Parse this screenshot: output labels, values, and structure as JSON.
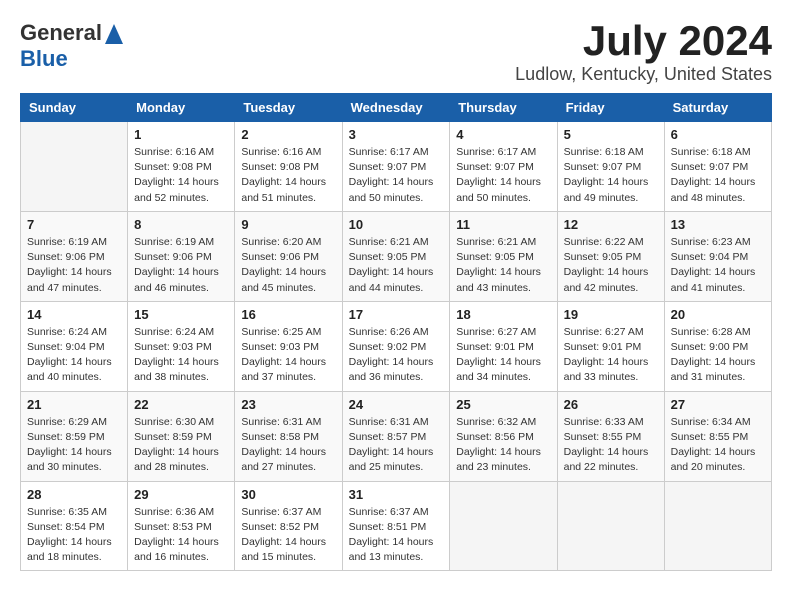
{
  "header": {
    "logo_general": "General",
    "logo_blue": "Blue",
    "month": "July 2024",
    "location": "Ludlow, Kentucky, United States"
  },
  "weekdays": [
    "Sunday",
    "Monday",
    "Tuesday",
    "Wednesday",
    "Thursday",
    "Friday",
    "Saturday"
  ],
  "weeks": [
    [
      {
        "day": "",
        "sunrise": "",
        "sunset": "",
        "daylight": ""
      },
      {
        "day": "1",
        "sunrise": "Sunrise: 6:16 AM",
        "sunset": "Sunset: 9:08 PM",
        "daylight": "Daylight: 14 hours and 52 minutes."
      },
      {
        "day": "2",
        "sunrise": "Sunrise: 6:16 AM",
        "sunset": "Sunset: 9:08 PM",
        "daylight": "Daylight: 14 hours and 51 minutes."
      },
      {
        "day": "3",
        "sunrise": "Sunrise: 6:17 AM",
        "sunset": "Sunset: 9:07 PM",
        "daylight": "Daylight: 14 hours and 50 minutes."
      },
      {
        "day": "4",
        "sunrise": "Sunrise: 6:17 AM",
        "sunset": "Sunset: 9:07 PM",
        "daylight": "Daylight: 14 hours and 50 minutes."
      },
      {
        "day": "5",
        "sunrise": "Sunrise: 6:18 AM",
        "sunset": "Sunset: 9:07 PM",
        "daylight": "Daylight: 14 hours and 49 minutes."
      },
      {
        "day": "6",
        "sunrise": "Sunrise: 6:18 AM",
        "sunset": "Sunset: 9:07 PM",
        "daylight": "Daylight: 14 hours and 48 minutes."
      }
    ],
    [
      {
        "day": "7",
        "sunrise": "Sunrise: 6:19 AM",
        "sunset": "Sunset: 9:06 PM",
        "daylight": "Daylight: 14 hours and 47 minutes."
      },
      {
        "day": "8",
        "sunrise": "Sunrise: 6:19 AM",
        "sunset": "Sunset: 9:06 PM",
        "daylight": "Daylight: 14 hours and 46 minutes."
      },
      {
        "day": "9",
        "sunrise": "Sunrise: 6:20 AM",
        "sunset": "Sunset: 9:06 PM",
        "daylight": "Daylight: 14 hours and 45 minutes."
      },
      {
        "day": "10",
        "sunrise": "Sunrise: 6:21 AM",
        "sunset": "Sunset: 9:05 PM",
        "daylight": "Daylight: 14 hours and 44 minutes."
      },
      {
        "day": "11",
        "sunrise": "Sunrise: 6:21 AM",
        "sunset": "Sunset: 9:05 PM",
        "daylight": "Daylight: 14 hours and 43 minutes."
      },
      {
        "day": "12",
        "sunrise": "Sunrise: 6:22 AM",
        "sunset": "Sunset: 9:05 PM",
        "daylight": "Daylight: 14 hours and 42 minutes."
      },
      {
        "day": "13",
        "sunrise": "Sunrise: 6:23 AM",
        "sunset": "Sunset: 9:04 PM",
        "daylight": "Daylight: 14 hours and 41 minutes."
      }
    ],
    [
      {
        "day": "14",
        "sunrise": "Sunrise: 6:24 AM",
        "sunset": "Sunset: 9:04 PM",
        "daylight": "Daylight: 14 hours and 40 minutes."
      },
      {
        "day": "15",
        "sunrise": "Sunrise: 6:24 AM",
        "sunset": "Sunset: 9:03 PM",
        "daylight": "Daylight: 14 hours and 38 minutes."
      },
      {
        "day": "16",
        "sunrise": "Sunrise: 6:25 AM",
        "sunset": "Sunset: 9:03 PM",
        "daylight": "Daylight: 14 hours and 37 minutes."
      },
      {
        "day": "17",
        "sunrise": "Sunrise: 6:26 AM",
        "sunset": "Sunset: 9:02 PM",
        "daylight": "Daylight: 14 hours and 36 minutes."
      },
      {
        "day": "18",
        "sunrise": "Sunrise: 6:27 AM",
        "sunset": "Sunset: 9:01 PM",
        "daylight": "Daylight: 14 hours and 34 minutes."
      },
      {
        "day": "19",
        "sunrise": "Sunrise: 6:27 AM",
        "sunset": "Sunset: 9:01 PM",
        "daylight": "Daylight: 14 hours and 33 minutes."
      },
      {
        "day": "20",
        "sunrise": "Sunrise: 6:28 AM",
        "sunset": "Sunset: 9:00 PM",
        "daylight": "Daylight: 14 hours and 31 minutes."
      }
    ],
    [
      {
        "day": "21",
        "sunrise": "Sunrise: 6:29 AM",
        "sunset": "Sunset: 8:59 PM",
        "daylight": "Daylight: 14 hours and 30 minutes."
      },
      {
        "day": "22",
        "sunrise": "Sunrise: 6:30 AM",
        "sunset": "Sunset: 8:59 PM",
        "daylight": "Daylight: 14 hours and 28 minutes."
      },
      {
        "day": "23",
        "sunrise": "Sunrise: 6:31 AM",
        "sunset": "Sunset: 8:58 PM",
        "daylight": "Daylight: 14 hours and 27 minutes."
      },
      {
        "day": "24",
        "sunrise": "Sunrise: 6:31 AM",
        "sunset": "Sunset: 8:57 PM",
        "daylight": "Daylight: 14 hours and 25 minutes."
      },
      {
        "day": "25",
        "sunrise": "Sunrise: 6:32 AM",
        "sunset": "Sunset: 8:56 PM",
        "daylight": "Daylight: 14 hours and 23 minutes."
      },
      {
        "day": "26",
        "sunrise": "Sunrise: 6:33 AM",
        "sunset": "Sunset: 8:55 PM",
        "daylight": "Daylight: 14 hours and 22 minutes."
      },
      {
        "day": "27",
        "sunrise": "Sunrise: 6:34 AM",
        "sunset": "Sunset: 8:55 PM",
        "daylight": "Daylight: 14 hours and 20 minutes."
      }
    ],
    [
      {
        "day": "28",
        "sunrise": "Sunrise: 6:35 AM",
        "sunset": "Sunset: 8:54 PM",
        "daylight": "Daylight: 14 hours and 18 minutes."
      },
      {
        "day": "29",
        "sunrise": "Sunrise: 6:36 AM",
        "sunset": "Sunset: 8:53 PM",
        "daylight": "Daylight: 14 hours and 16 minutes."
      },
      {
        "day": "30",
        "sunrise": "Sunrise: 6:37 AM",
        "sunset": "Sunset: 8:52 PM",
        "daylight": "Daylight: 14 hours and 15 minutes."
      },
      {
        "day": "31",
        "sunrise": "Sunrise: 6:37 AM",
        "sunset": "Sunset: 8:51 PM",
        "daylight": "Daylight: 14 hours and 13 minutes."
      },
      {
        "day": "",
        "sunrise": "",
        "sunset": "",
        "daylight": ""
      },
      {
        "day": "",
        "sunrise": "",
        "sunset": "",
        "daylight": ""
      },
      {
        "day": "",
        "sunrise": "",
        "sunset": "",
        "daylight": ""
      }
    ]
  ]
}
